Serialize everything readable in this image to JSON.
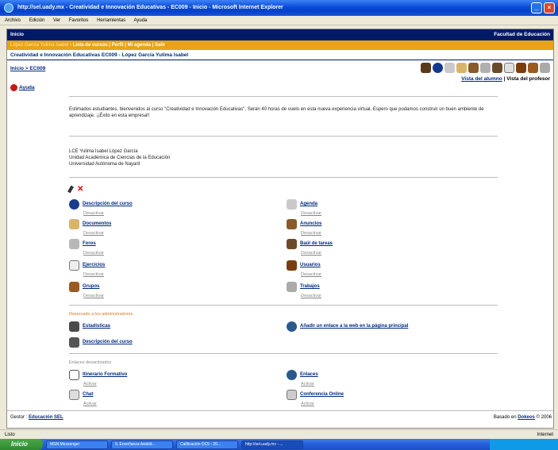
{
  "window": {
    "title": "http://sel.uady.mx - Creatividad e Innovación Educativas - EC009 - Inicio - Microsoft Internet Explorer"
  },
  "menu": [
    "Archivo",
    "Edición",
    "Ver",
    "Favoritos",
    "Herramientas",
    "Ayuda"
  ],
  "header": {
    "left": "Inicio",
    "right": "Facultad de Educación",
    "user": "López García Yulima Isabel",
    "links": "- Lista de cursos | Perfil | Mi agenda | Salir",
    "course": "Creatividad e Innovación Educativas EC009 - López García Yulima Isabel"
  },
  "breadcrumb": "Inicio > EC009",
  "views": {
    "student": "Vista del alumno",
    "sep": " | ",
    "teacher": "Vista del profesor"
  },
  "help": "Ayuda",
  "intro": "Estimados estudiantes, bienvenidos al curso \"Creatividad e Innovación Educativas\". Serán 40 horas de vuelo en esta nueva experiencia virtual. Espero que podamos construir un buen ambiente de aprendizaje. ¡¡Éxito en esta empresa!!",
  "signature": [
    "LCE Yulima Isabel López García",
    "Unidad Académica de Ciencias de la Educación",
    "Universidad Autónoma de Nayarit"
  ],
  "tools": {
    "descripcion": {
      "label": "Descripción del curso",
      "action": "Desactivar"
    },
    "agenda": {
      "label": "Agenda",
      "action": "Desactivar"
    },
    "documentos": {
      "label": "Documentos",
      "action": "Desactivar"
    },
    "anuncios": {
      "label": "Anuncios",
      "action": "Desactivar"
    },
    "foros": {
      "label": "Foros",
      "action": "Desactivar"
    },
    "baul": {
      "label": "Baúl de tareas",
      "action": "Desactivar"
    },
    "ejercicios": {
      "label": "Ejercicios",
      "action": "Desactivar"
    },
    "usuarios": {
      "label": "Usuarios",
      "action": "Desactivar"
    },
    "grupos": {
      "label": "Grupos",
      "action": "Desactivar"
    },
    "trabajos": {
      "label": "Trabajos",
      "action": "Desactivar"
    }
  },
  "admin": {
    "title": "Reservado a los administradores",
    "estadisticas": "Estadísticas",
    "enlace": "Añadir un enlace a la web en la página principal",
    "descripcion": "Descripción del curso"
  },
  "disabled": {
    "title": "Enlaces desactivados",
    "itinerario": {
      "label": "Itinerario Formativo",
      "action": "Activar"
    },
    "enlaces": {
      "label": "Enlaces",
      "action": "Activar"
    },
    "chat": {
      "label": "Chat",
      "action": "Activar"
    },
    "conferencia": {
      "label": "Conferencia Online",
      "action": "Activar"
    }
  },
  "footer": {
    "gestor_label": "Gestor : ",
    "gestor": "Educación SEL",
    "powered_label": "Basado en ",
    "powered": "Dokeos",
    "year": " © 2006"
  },
  "status": {
    "left": "Listo",
    "right": "Internet"
  },
  "taskbar": {
    "start": "Inicio",
    "items": [
      "MSN Messenger",
      "9. Enseñanza Asistid...",
      "Calificación DC5 - 20...",
      "http://sel.uady.mx - ..."
    ]
  },
  "colors": {
    "accent": "#001a66",
    "orange": "#e8a317",
    "link": "#002a80"
  },
  "icons": [
    "ie-icon",
    "minimize-icon",
    "maximize-icon",
    "close-icon",
    "help-icon",
    "edit-icon",
    "delete-icon"
  ]
}
